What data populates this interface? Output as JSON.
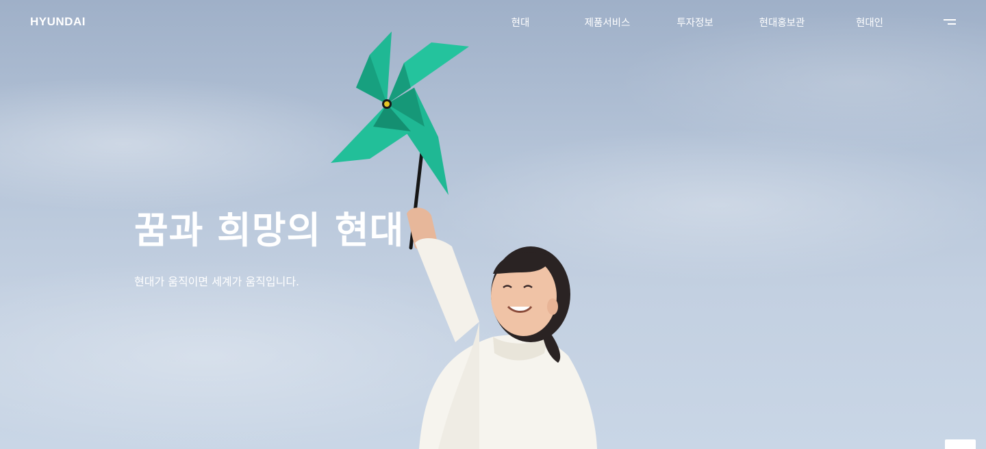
{
  "header": {
    "logo": "HYUNDAI",
    "nav": [
      {
        "label": "현대"
      },
      {
        "label": "제품서비스"
      },
      {
        "label": "투자정보"
      },
      {
        "label": "현대홍보관"
      },
      {
        "label": "현대인"
      }
    ],
    "menu_icon": "hamburger-icon"
  },
  "hero": {
    "headline": "꿈과 희망의 현대",
    "subline": "현대가 움직이면 세계가 움직입니다.",
    "pinwheel_color": "#1fb894",
    "sky_color": "#b9c7da"
  }
}
